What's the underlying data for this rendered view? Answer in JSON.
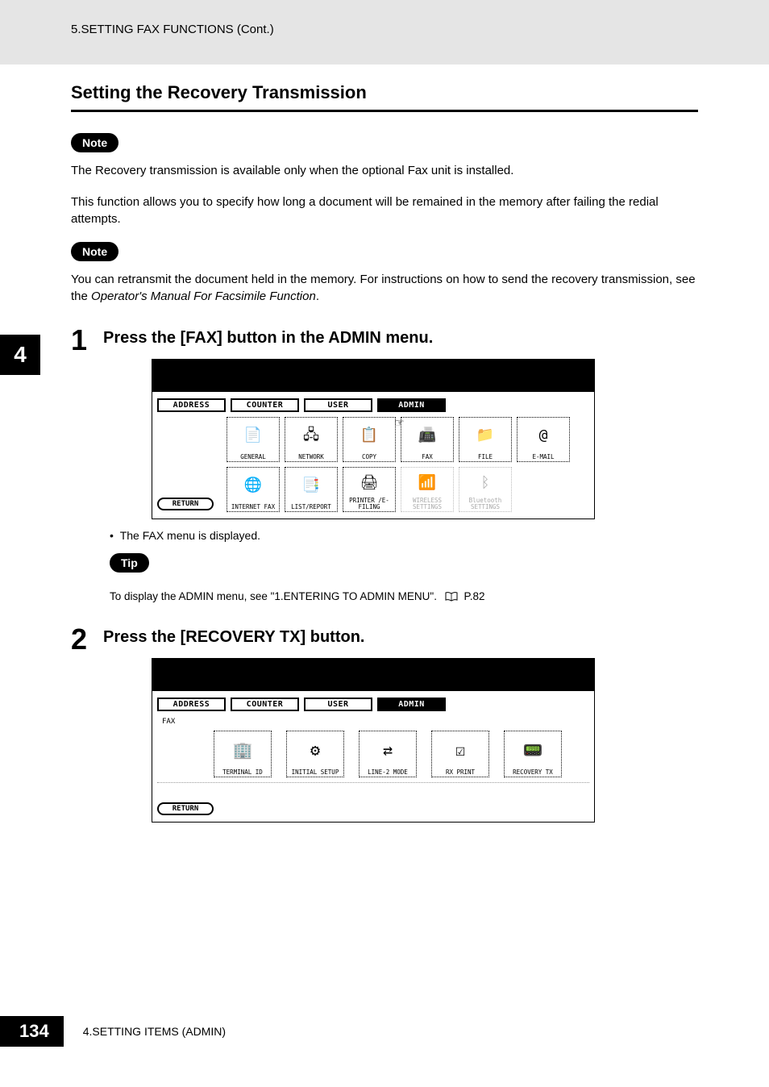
{
  "header": {
    "running_title": "5.SETTING FAX FUNCTIONS (Cont.)"
  },
  "section": {
    "title": "Setting the Recovery Transmission"
  },
  "pills": {
    "note": "Note",
    "tip": "Tip"
  },
  "paras": {
    "p1": "The Recovery transmission is available only when the optional Fax unit is installed.",
    "p2": "This function allows you to specify how long a document will be remained in the memory after failing the redial attempts.",
    "p3a": "You can retransmit the document held in the memory.  For instructions on how to send the recovery transmission, see the ",
    "p3b": "Operator's Manual For Facsimile Function",
    "p3c": "."
  },
  "side_tab": "4",
  "steps": {
    "s1": {
      "num": "1",
      "title": "Press the [FAX] button in the ADMIN menu.",
      "note": "The FAX menu is displayed."
    },
    "s2": {
      "num": "2",
      "title": "Press the [RECOVERY TX] button."
    }
  },
  "tip_ref": {
    "text": "To display the ADMIN menu, see \"1.ENTERING TO ADMIN MENU\".",
    "page": "P.82"
  },
  "lcd1": {
    "tabs": [
      "ADDRESS",
      "COUNTER",
      "USER",
      "ADMIN"
    ],
    "active_tab_index": 3,
    "row1": [
      {
        "label": "GENERAL",
        "glyph": "📄"
      },
      {
        "label": "NETWORK",
        "glyph": "🖧"
      },
      {
        "label": "COPY",
        "glyph": "📋"
      },
      {
        "label": "FAX",
        "glyph": "📠"
      },
      {
        "label": "FILE",
        "glyph": "📁"
      },
      {
        "label": "E-MAIL",
        "glyph": "@"
      }
    ],
    "row2": [
      {
        "label": "INTERNET FAX",
        "glyph": "🌐",
        "disabled": false
      },
      {
        "label": "LIST/REPORT",
        "glyph": "📑",
        "disabled": false
      },
      {
        "label": "PRINTER /E-FILING",
        "glyph": "🖨",
        "disabled": false
      },
      {
        "label": "WIRELESS SETTINGS",
        "glyph": "📶",
        "disabled": true
      },
      {
        "label": "Bluetooth SETTINGS",
        "glyph": "ᛒ",
        "disabled": true
      }
    ],
    "return": "RETURN"
  },
  "lcd2": {
    "tabs": [
      "ADDRESS",
      "COUNTER",
      "USER",
      "ADMIN"
    ],
    "active_tab_index": 3,
    "subtitle": "FAX",
    "buttons": [
      {
        "label": "TERMINAL ID",
        "glyph": "🏢"
      },
      {
        "label": "INITIAL SETUP",
        "glyph": "⚙"
      },
      {
        "label": "LINE-2 MODE",
        "glyph": "⇄"
      },
      {
        "label": "RX PRINT",
        "glyph": "☑"
      },
      {
        "label": "RECOVERY TX",
        "glyph": "📟"
      }
    ],
    "return": "RETURN"
  },
  "footer": {
    "page": "134",
    "text": "4.SETTING ITEMS (ADMIN)"
  }
}
